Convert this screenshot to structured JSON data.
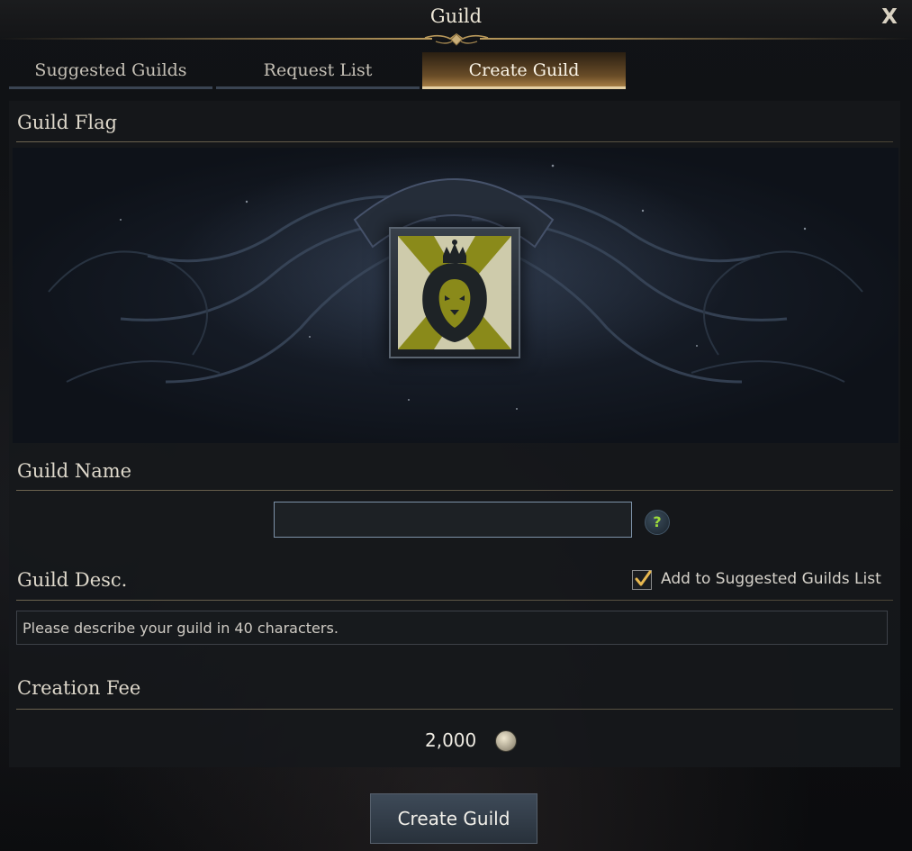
{
  "window": {
    "title": "Guild",
    "close_label": "X"
  },
  "tabs": [
    {
      "label": "Suggested Guilds",
      "active": false
    },
    {
      "label": "Request List",
      "active": false
    },
    {
      "label": "Create Guild",
      "active": true
    }
  ],
  "sections": {
    "flag_title": "Guild Flag",
    "name_title": "Guild Name",
    "desc_title": "Guild Desc.",
    "fee_title": "Creation Fee"
  },
  "flag": {
    "emblem_icon": "crowned-lion-icon",
    "background_color": "#8a8a1a"
  },
  "name_input": {
    "value": "",
    "placeholder": ""
  },
  "help": {
    "label": "?"
  },
  "suggested_checkbox": {
    "label": "Add to Suggested Guilds List",
    "checked": true
  },
  "desc_input": {
    "value": "",
    "placeholder": "Please describe your guild in 40 characters."
  },
  "fee": {
    "amount": "2,000",
    "currency_icon": "silver-coin-icon"
  },
  "create_button": {
    "label": "Create Guild"
  },
  "colors": {
    "accent_gold": "#b9995b",
    "help_green": "#9edc3a"
  }
}
